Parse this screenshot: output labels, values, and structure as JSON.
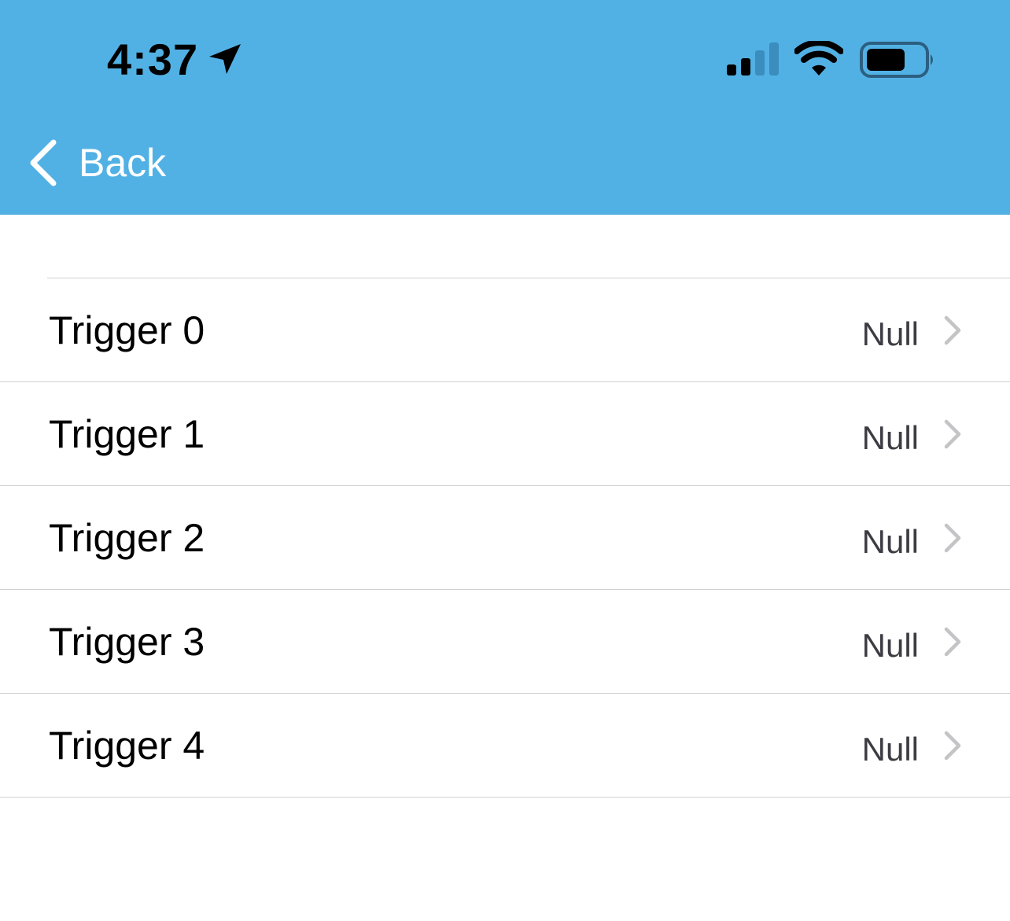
{
  "status_bar": {
    "time": "4:37",
    "icons": [
      "location-arrow-icon",
      "cellular-signal-icon",
      "wifi-icon",
      "battery-icon"
    ]
  },
  "nav": {
    "back_label": "Back",
    "background_color": "#52b1e4"
  },
  "list": {
    "items": [
      {
        "label": "Trigger 0",
        "value": "Null"
      },
      {
        "label": "Trigger 1",
        "value": "Null"
      },
      {
        "label": "Trigger 2",
        "value": "Null"
      },
      {
        "label": "Trigger 3",
        "value": "Null"
      },
      {
        "label": "Trigger 4",
        "value": "Null"
      }
    ]
  }
}
